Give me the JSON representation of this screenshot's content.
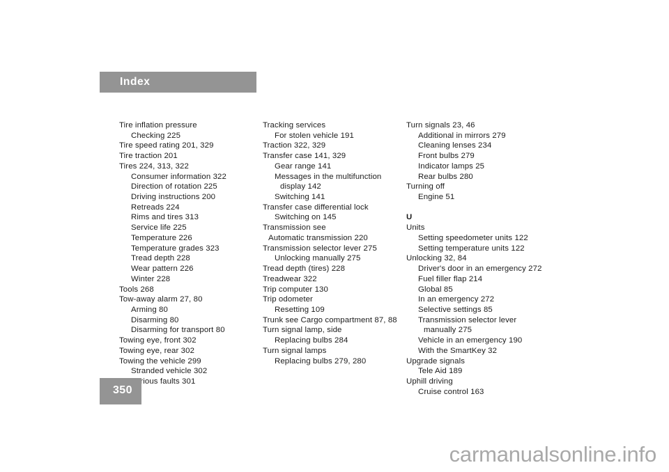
{
  "document": {
    "header_title": "Index",
    "page_number": "350",
    "watermark": "carmanualsonline.info",
    "header_bar_color": "#949494",
    "page_box_color": "#949494",
    "text_color": "#1b1b1b",
    "background_color": "#ffffff",
    "watermark_color": "#a9a9a9"
  },
  "columns": [
    {
      "id": "column-1",
      "entries": [
        {
          "text": "Tire inflation pressure",
          "level": 0
        },
        {
          "text": "Checking 225",
          "level": 1
        },
        {
          "text": "Tire speed rating 201, 329",
          "level": 0
        },
        {
          "text": "Tire traction 201",
          "level": 0
        },
        {
          "text": "Tires 224, 313, 322",
          "level": 0
        },
        {
          "text": "Consumer information 322",
          "level": 1
        },
        {
          "text": "Direction of rotation 225",
          "level": 1
        },
        {
          "text": "Driving instructions 200",
          "level": 1
        },
        {
          "text": "Retreads 224",
          "level": 1
        },
        {
          "text": "Rims and tires 313",
          "level": 1
        },
        {
          "text": "Service life 225",
          "level": 1
        },
        {
          "text": "Temperature 226",
          "level": 1
        },
        {
          "text": "Temperature grades 323",
          "level": 1
        },
        {
          "text": "Tread depth 228",
          "level": 1
        },
        {
          "text": "Wear pattern 226",
          "level": 1
        },
        {
          "text": "Winter 228",
          "level": 1
        },
        {
          "text": "Tools 268",
          "level": 0
        },
        {
          "text": "Tow-away alarm 27, 80",
          "level": 0
        },
        {
          "text": "Arming 80",
          "level": 1
        },
        {
          "text": "Disarming 80",
          "level": 1
        },
        {
          "text": "Disarming for transport 80",
          "level": 1
        },
        {
          "text": "Towing eye, front 302",
          "level": 0
        },
        {
          "text": "Towing eye, rear 302",
          "level": 0
        },
        {
          "text": "Towing the vehicle 299",
          "level": 0
        },
        {
          "text": "Stranded vehicle 302",
          "level": 1
        },
        {
          "text": "Various faults 301",
          "level": 1
        }
      ]
    },
    {
      "id": "column-2",
      "entries": [
        {
          "text": "Tracking services",
          "level": 0
        },
        {
          "text": "For stolen vehicle 191",
          "level": 1
        },
        {
          "text": "Traction 322, 329",
          "level": 0
        },
        {
          "text": "Transfer case 141, 329",
          "level": 0
        },
        {
          "text": "Gear range 141",
          "level": 1
        },
        {
          "text": "Messages in the multifunction",
          "level": 1
        },
        {
          "text": "display 142",
          "level": 2
        },
        {
          "text": "Switching 141",
          "level": 1
        },
        {
          "text": "Transfer case differential lock",
          "level": 0
        },
        {
          "text": "Switching on 145",
          "level": 1
        },
        {
          "text": "Transmission see",
          "level": 0
        },
        {
          "text": "Automatic transmission 220",
          "level": 3
        },
        {
          "text": "Transmission selector lever 275",
          "level": 0
        },
        {
          "text": "Unlocking manually 275",
          "level": 1
        },
        {
          "text": "Tread depth (tires) 228",
          "level": 0
        },
        {
          "text": "Treadwear 322",
          "level": 0
        },
        {
          "text": "Trip computer 130",
          "level": 0
        },
        {
          "text": "Trip odometer",
          "level": 0
        },
        {
          "text": "Resetting 109",
          "level": 1
        },
        {
          "text": "Trunk see Cargo compartment 87, 88",
          "level": 0
        },
        {
          "text": "Turn signal lamp, side",
          "level": 0
        },
        {
          "text": "Replacing bulbs 284",
          "level": 1
        },
        {
          "text": "Turn signal lamps",
          "level": 0
        },
        {
          "text": "Replacing bulbs 279, 280",
          "level": 1
        }
      ]
    },
    {
      "id": "column-3",
      "entries": [
        {
          "text": "Turn signals 23, 46",
          "level": 0
        },
        {
          "text": "Additional in mirrors 279",
          "level": 1
        },
        {
          "text": "Cleaning lenses 234",
          "level": 1
        },
        {
          "text": "Front bulbs 279",
          "level": 1
        },
        {
          "text": "Indicator lamps 25",
          "level": 1
        },
        {
          "text": "Rear bulbs 280",
          "level": 1
        },
        {
          "text": "Turning off",
          "level": 0
        },
        {
          "text": "Engine 51",
          "level": 1
        },
        {
          "text": "",
          "level": -1
        },
        {
          "text": "U",
          "level": 9
        },
        {
          "text": "Units",
          "level": 0
        },
        {
          "text": "Setting speedometer units 122",
          "level": 1
        },
        {
          "text": "Setting temperature units 122",
          "level": 1
        },
        {
          "text": "Unlocking 32, 84",
          "level": 0
        },
        {
          "text": "Driver's door in an emergency 272",
          "level": 1
        },
        {
          "text": "Fuel filler flap 214",
          "level": 1
        },
        {
          "text": "Global 85",
          "level": 1
        },
        {
          "text": "In an emergency 272",
          "level": 1
        },
        {
          "text": "Selective settings 85",
          "level": 1
        },
        {
          "text": "Transmission selector lever",
          "level": 1
        },
        {
          "text": "manually 275",
          "level": 2
        },
        {
          "text": "Vehicle in an emergency 190",
          "level": 1
        },
        {
          "text": "With the SmartKey 32",
          "level": 1
        },
        {
          "text": "Upgrade signals",
          "level": 0
        },
        {
          "text": "Tele Aid 189",
          "level": 1
        },
        {
          "text": "Uphill driving",
          "level": 0
        },
        {
          "text": "Cruise control 163",
          "level": 1
        }
      ]
    }
  ]
}
